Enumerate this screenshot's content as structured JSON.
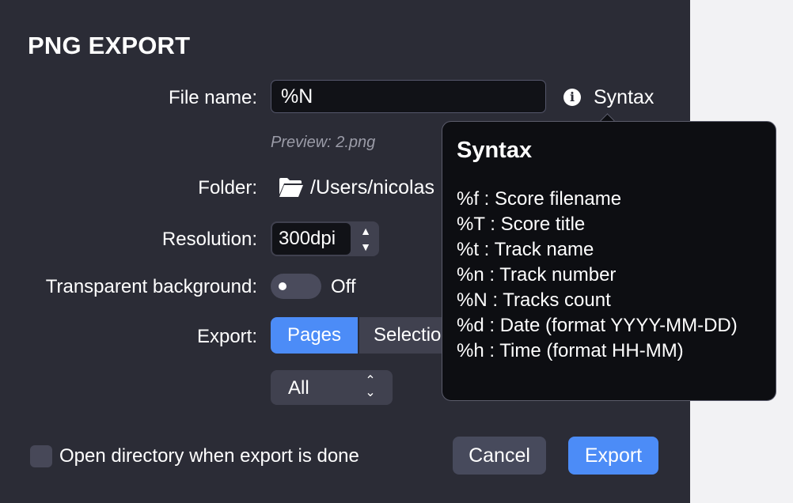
{
  "dialog": {
    "title": "PNG EXPORT",
    "file_name": {
      "label": "File name:",
      "value": "%N"
    },
    "syntax_link": "Syntax",
    "info_icon": "info-icon",
    "preview": "Preview: 2.png",
    "folder": {
      "label": "Folder:",
      "path": "/Users/nicolas",
      "icon": "folder-icon"
    },
    "resolution": {
      "label": "Resolution:",
      "value": "300dpi",
      "up": "▲",
      "down": "▼"
    },
    "transparent": {
      "label": "Transparent background:",
      "state": "Off"
    },
    "export": {
      "label": "Export:",
      "segments": [
        "Pages",
        "Selection"
      ],
      "selected": "Pages",
      "range": "All"
    },
    "open_directory": "Open directory when export is done",
    "cancel": "Cancel",
    "export_button": "Export"
  },
  "tooltip": {
    "title": "Syntax",
    "items": [
      "%f : Score filename",
      "%T : Score title",
      "%t : Track name",
      "%n : Track number",
      "%N : Tracks count",
      "%d : Date (format YYYY-MM-DD)",
      "%h : Time (format HH-MM)"
    ]
  },
  "colors": {
    "dialog_bg": "#2b2c36",
    "accent": "#4c8cf7",
    "tooltip_bg": "#0d0e12"
  }
}
